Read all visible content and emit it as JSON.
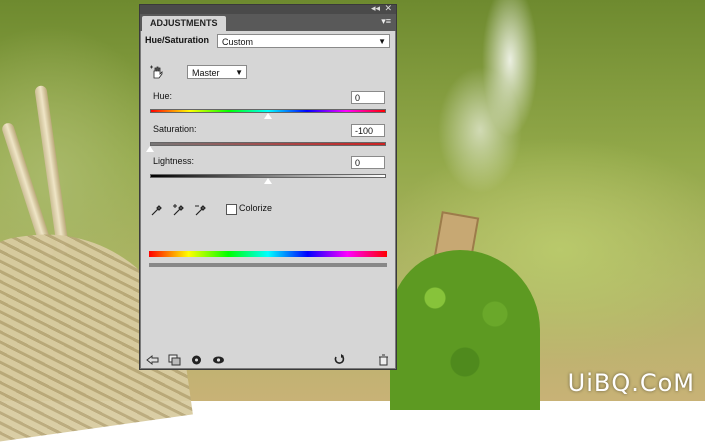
{
  "panel": {
    "tab": "ADJUSTMENTS",
    "adjustment_title": "Hue/Saturation",
    "preset_value": "Custom",
    "channel_value": "Master",
    "hue": {
      "label": "Hue:",
      "value": "0",
      "slider_fraction": 0.5
    },
    "saturation": {
      "label": "Saturation:",
      "value": "-100",
      "slider_fraction": 0.0
    },
    "lightness": {
      "label": "Lightness:",
      "value": "0",
      "slider_fraction": 0.5
    },
    "colorize": {
      "label": "Colorize",
      "checked": false
    }
  },
  "icons": {
    "collapse": "double-chevron-left-icon",
    "close": "close-icon",
    "panel_menu": "panel-menu-icon",
    "hand": "targeted-adjustment-hand-icon",
    "eyedroppers": [
      "eyedropper-icon",
      "eyedropper-plus-icon",
      "eyedropper-minus-icon"
    ],
    "footer": [
      "back-arrow-icon",
      "clip-to-layer-icon",
      "visibility-icon",
      "view-previous-icon",
      "reset-icon",
      "trash-icon"
    ]
  },
  "watermark": "UiBQ.CoM"
}
